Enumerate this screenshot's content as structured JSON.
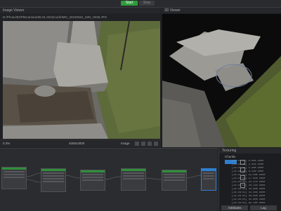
{
  "topbar": {
    "start_label": "Start",
    "stop_label": "Stop"
  },
  "image_viewer": {
    "title": "Image Viewer",
    "path": "D:/Photo/3D/PhtCamera/05.01.2023/curb/IMG_20230501_IMG_0038.JPG",
    "zoom": "0.3%",
    "resolution": "4000x3000",
    "size_label": "Image"
  },
  "viewer_3d": {
    "title": "3D Viewer"
  },
  "task_panel": {
    "title": "Texturing",
    "subtitle": "Chunks",
    "log_lines": [
      "[14:28:45] 0.00% Done",
      "[14:28:45] 2.45% Done",
      "[14:28:46] 5.20% Done",
      "[14:28:46] 8.13% Done",
      "[14:28:47] 12.50% Done",
      "[14:28:48] 17.02% Done",
      "[14:28:49] 22.37% Done",
      "[14:28:50] 28.11% Done",
      "[14:28:51] 33.90% Done",
      "[14:28:52] 41.45% Done",
      "[14:28:53] 48.02% Done",
      "[14:28:54] 55.60% Done",
      "[14:28:55] 62.14% Done"
    ],
    "button_left": "Attributes",
    "button_right": "Log"
  },
  "colors": {
    "accent_green": "#2e9d3a",
    "node_selected": "#2f7fd0"
  }
}
